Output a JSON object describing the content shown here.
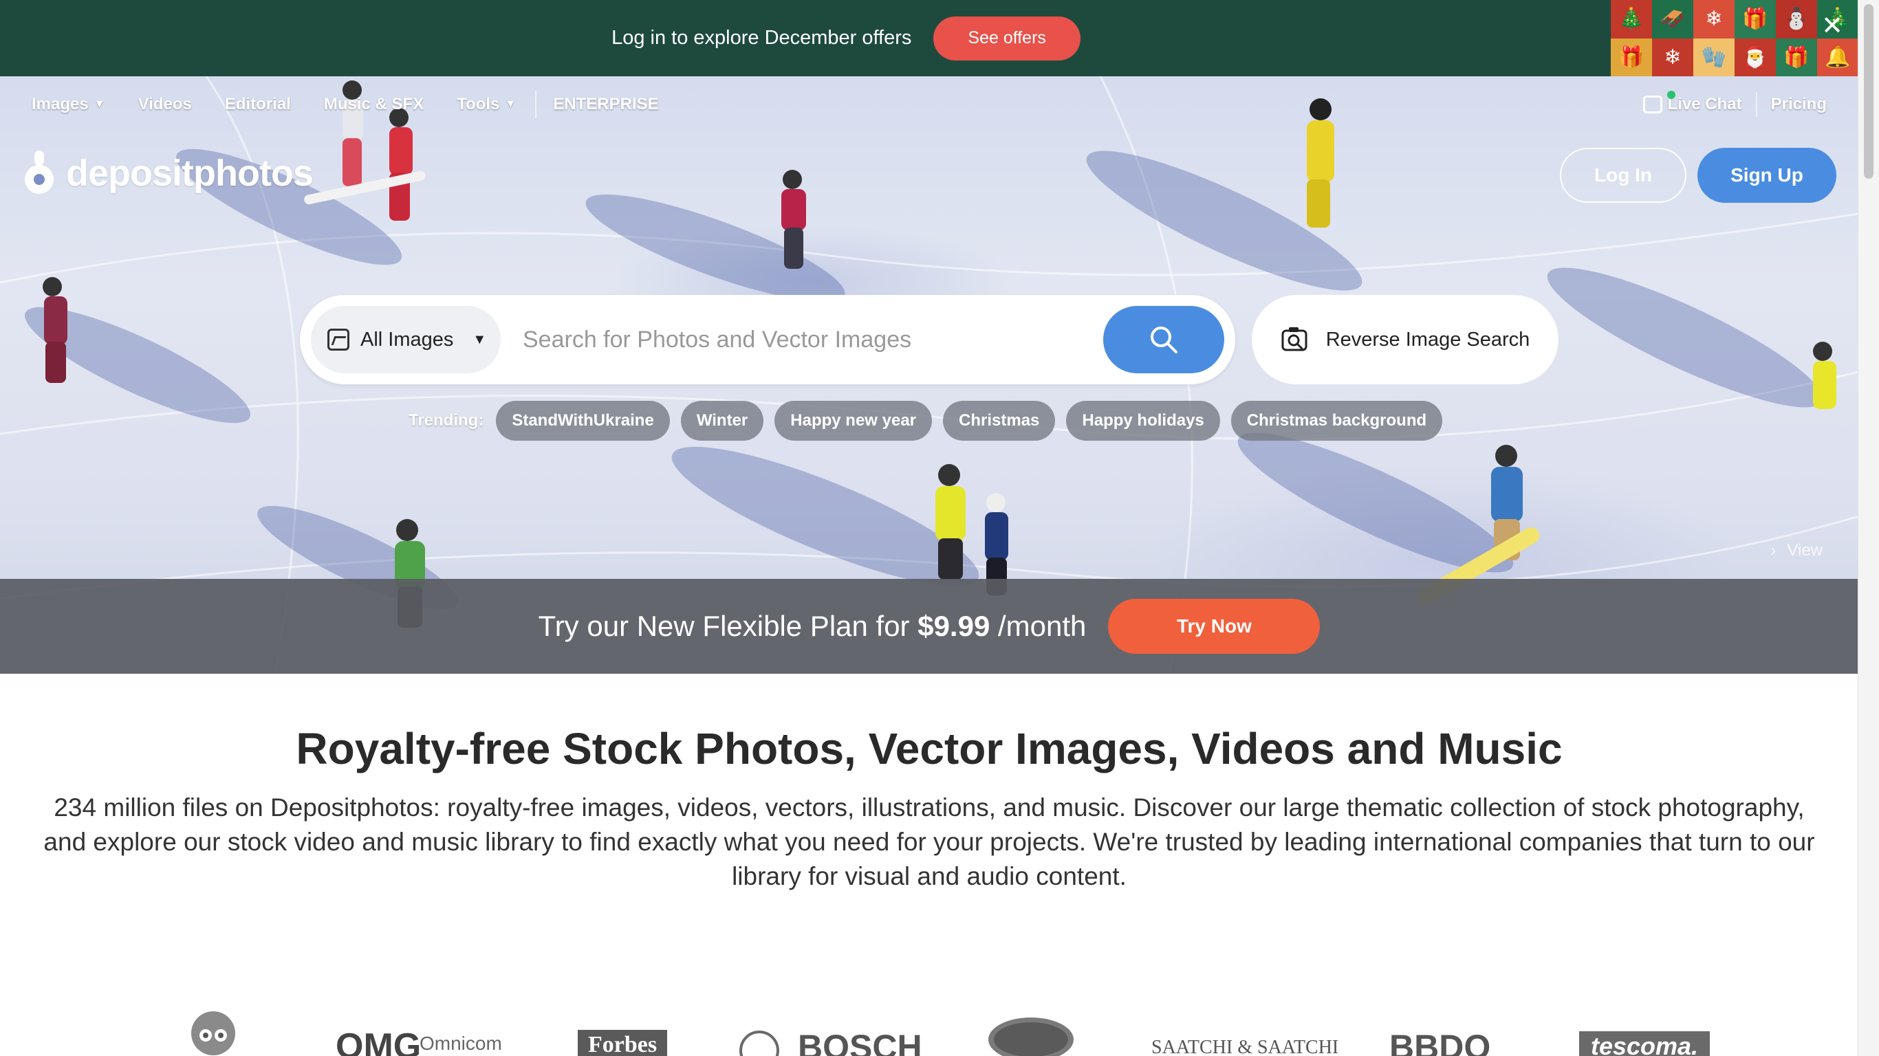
{
  "promo": {
    "text": "Log in to explore December offers",
    "button": "See offers",
    "close": "✕",
    "pattern": [
      "🎄",
      "🛷",
      "❄",
      "🎁",
      "⛄",
      "🎄",
      "🎁",
      "❄",
      "🧤",
      "🎅",
      "🎁",
      "🔔"
    ]
  },
  "nav": {
    "images": "Images",
    "videos": "Videos",
    "editorial": "Editorial",
    "music": "Music & SFX",
    "tools": "Tools",
    "enterprise": "ENTERPRISE",
    "live_chat": "Live Chat",
    "pricing": "Pricing"
  },
  "logo": {
    "text": "depositphotos"
  },
  "auth": {
    "login": "Log In",
    "signup": "Sign Up"
  },
  "search": {
    "type": "All Images",
    "placeholder": "Search for Photos and Vector Images",
    "reverse": "Reverse Image Search"
  },
  "trending": {
    "label": "Trending:",
    "tags": [
      "StandWithUkraine",
      "Winter",
      "Happy new year",
      "Christmas",
      "Happy holidays",
      "Christmas background"
    ]
  },
  "hero": {
    "view": "View"
  },
  "flex_plan": {
    "text": "Try our New Flexible Plan for",
    "price": "$9.99",
    "period": "/month",
    "button": "Try Now"
  },
  "content": {
    "headline": "Royalty-free Stock Photos, Vector Images, Videos and Music",
    "description": "234 million files on Depositphotos: royalty-free images, videos, vectors, illustrations, and music. Discover our large thematic collection of stock photography, and explore our stock video and music library to find exactly what you need for your projects. We're trusted by leading international companies that turn to our library for visual and audio content."
  },
  "brands": [
    "OMG",
    "Omnicom",
    "Forbes",
    "BOSCH",
    "SAATCHI & SAATCHI",
    "BBDO",
    "tescoma."
  ],
  "colors": {
    "promo_bg": "#1e4a3e",
    "promo_button": "#e8524a",
    "primary_blue": "#4a8de0",
    "try_button": "#f0603c"
  }
}
